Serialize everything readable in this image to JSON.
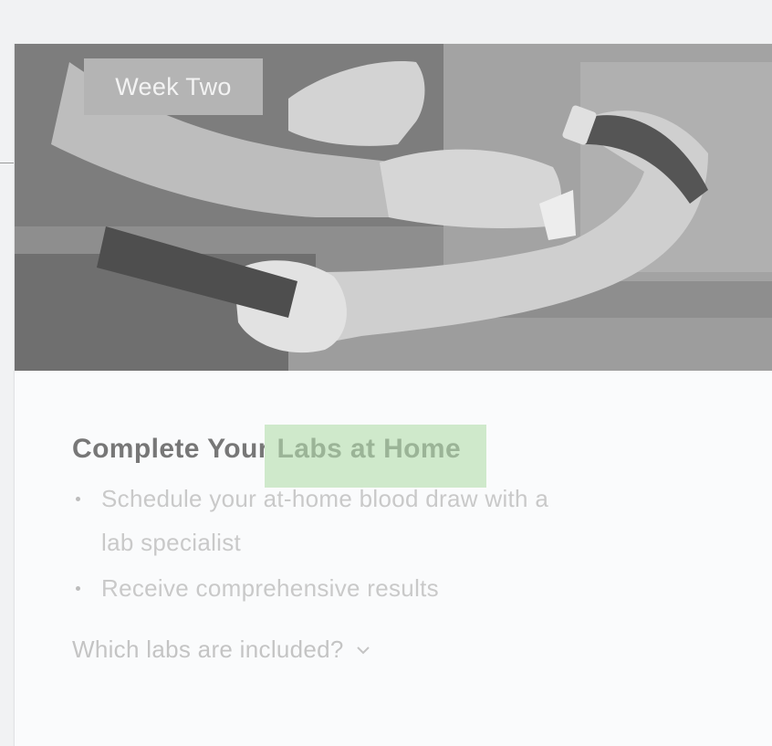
{
  "card": {
    "badge": "Week Two",
    "title_prefix": "Complete Your ",
    "title_highlight": "Labs at Home",
    "bullets": [
      {
        "line1": "Schedule your at-home blood draw with a",
        "line2": "lab specialist"
      },
      {
        "line1": "Receive comprehensive results",
        "line2": ""
      }
    ],
    "toggle_label": "Which labs are included?",
    "toggle_icon": "chevron-down-icon"
  },
  "hero": {
    "image_subject": "blood draw"
  },
  "colors": {
    "highlight": "#cfe9cb",
    "badge_bg": "#b4b4b4",
    "card_bg": "#fafbfc"
  }
}
